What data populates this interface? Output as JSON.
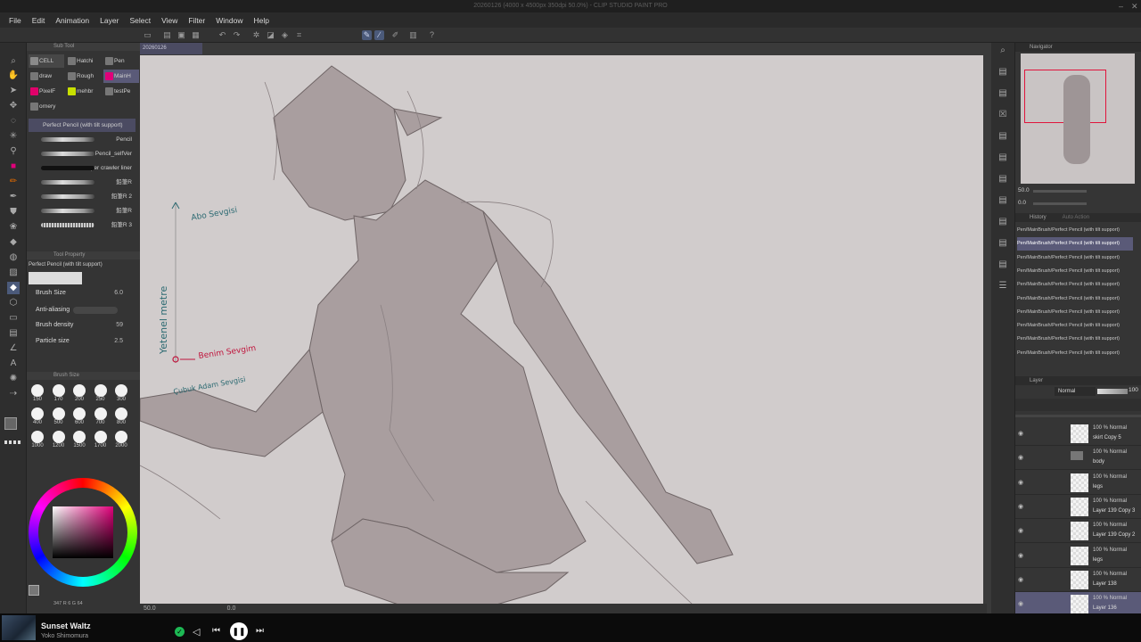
{
  "window": {
    "title": "20260126 (4000 x 4500px 350dpi 50.0%) - CLIP STUDIO PAINT PRO"
  },
  "menu": [
    "File",
    "Edit",
    "Animation",
    "Layer",
    "Select",
    "View",
    "Filter",
    "Window",
    "Help"
  ],
  "canvas": {
    "tab": "20260126",
    "zoom": "50.0",
    "angle": "0.0"
  },
  "subtool": {
    "header": "Sub Tool",
    "tabs": [
      "CELL",
      "Hatchi",
      "Pen",
      "draw",
      "Rough",
      "MainH",
      "PixelF",
      "mehbr",
      "testPe",
      "ornery"
    ],
    "brushes": [
      "Perfect Pencil (with tilt support)",
      "Pencil",
      "Pencil_selfVer",
      "creeper crawler liner",
      "鉛筆R",
      "鉛筆R 2",
      "鉛筆R",
      "鉛筆R 3"
    ]
  },
  "toolprop": {
    "header": "Tool Property",
    "name": "Perfect Pencil (with tilt support)",
    "rows": [
      {
        "label": "Brush Size",
        "value": "6.0"
      },
      {
        "label": "Anti-aliasing",
        "value": ""
      },
      {
        "label": "Brush density",
        "value": "59"
      },
      {
        "label": "Particle size",
        "value": "2.5"
      }
    ]
  },
  "brushsize": {
    "header": "Brush Size",
    "sizes": [
      "150",
      "170",
      "200",
      "250",
      "300",
      "400",
      "500",
      "600",
      "700",
      "800",
      "1000",
      "1200",
      "1500",
      "1700",
      "2000"
    ]
  },
  "colorinfo": "347 R  6 G  64",
  "annotations": {
    "a1": "Abo Sevgisi",
    "a2": "Benim Sevgim",
    "a3": "Çubuk Adam Sevgisi",
    "a4": "Yetenel metre"
  },
  "navigator": {
    "title": "Navigator",
    "zoom": "50.0",
    "angle": "0.0"
  },
  "history": {
    "tab1": "History",
    "tab2": "Auto Action",
    "items": [
      "Pen/MainBrush/Perfect Pencil (with tilt support)",
      "Pen/MainBrush/Perfect Pencil (with tilt support)",
      "Pen/MainBrush/Perfect Pencil (with tilt support)",
      "Pen/MainBrush/Perfect Pencil (with tilt support)",
      "Pen/MainBrush/Perfect Pencil (with tilt support)",
      "Pen/MainBrush/Perfect Pencil (with tilt support)",
      "Pen/MainBrush/Perfect Pencil (with tilt support)",
      "Pen/MainBrush/Perfect Pencil (with tilt support)",
      "Pen/MainBrush/Perfect Pencil (with tilt support)",
      "Pen/MainBrush/Perfect Pencil (with tilt support)"
    ]
  },
  "layers": {
    "title": "Layer",
    "blend": "Normal",
    "opacity": "100",
    "rows": [
      {
        "mode": "100 % Normal",
        "name": "skirt Copy 5"
      },
      {
        "mode": "100 % Normal",
        "name": "body"
      },
      {
        "mode": "100 % Normal",
        "name": "legs"
      },
      {
        "mode": "100 % Normal",
        "name": "Layer 139 Copy 3"
      },
      {
        "mode": "100 % Normal",
        "name": "Layer 139 Copy 2"
      },
      {
        "mode": "100 % Normal",
        "name": "legs"
      },
      {
        "mode": "100 % Normal",
        "name": "Layer 138"
      },
      {
        "mode": "100 % Normal",
        "name": "Layer 136"
      }
    ]
  },
  "player": {
    "title": "Sunset Waltz",
    "artist": "Yoko Shimomura"
  },
  "colors": {
    "accent": "#e0007a",
    "selected": "#5a5a78",
    "paper": "#d1cccc"
  }
}
